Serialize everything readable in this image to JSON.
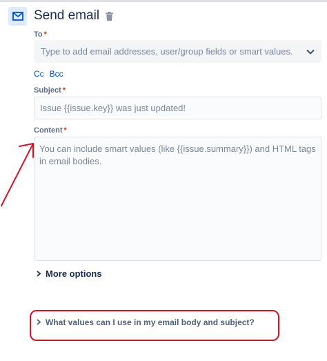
{
  "header": {
    "title": "Send email"
  },
  "to": {
    "label": "To",
    "required_mark": "*",
    "placeholder": "Type to add email addresses, user/group fields or smart values."
  },
  "cc_label": "Cc",
  "bcc_label": "Bcc",
  "subject": {
    "label": "Subject",
    "required_mark": "*",
    "placeholder": "Issue {{issue.key}} was just updated!"
  },
  "content": {
    "label": "Content",
    "required_mark": "*",
    "placeholder": "You can include smart values (like {{issue.summary}}) and HTML tags in email bodies."
  },
  "more_options": {
    "label": "More options"
  },
  "help": {
    "label": "What values can I use in my email body and subject?"
  },
  "annotation_color": "#d8102a"
}
